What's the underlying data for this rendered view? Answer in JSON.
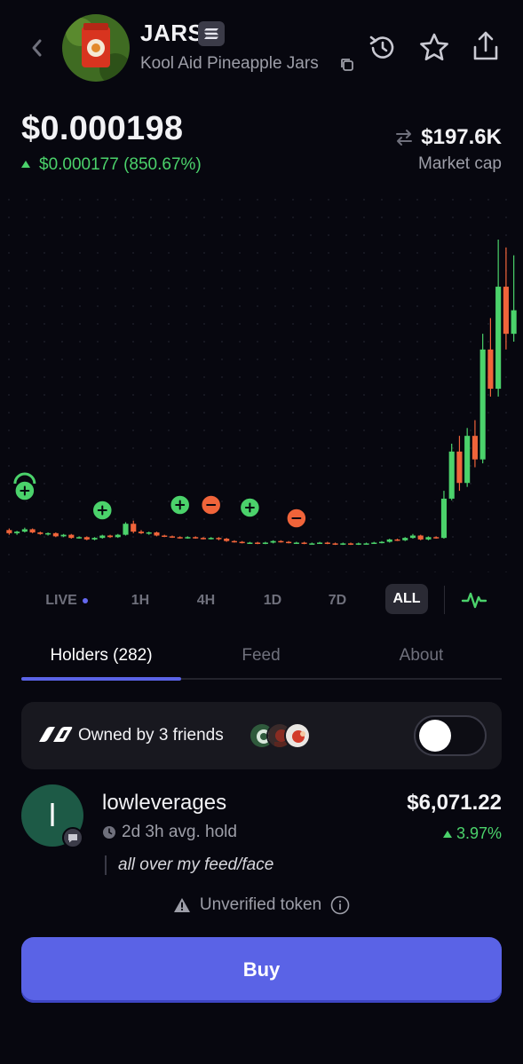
{
  "header": {
    "ticker": "JARS",
    "token_name": "Kool Aid Pineapple Jars",
    "icons": [
      "back-icon",
      "chain-badge-icon",
      "copy-icon",
      "history-icon",
      "star-icon",
      "share-icon"
    ]
  },
  "price": {
    "current": "$0.000198",
    "change": "$0.000177 (850.67%)",
    "market_cap_value": "$197.6K",
    "market_cap_label": "Market cap"
  },
  "chart_data": {
    "type": "candlestick",
    "title": "",
    "xlabel": "",
    "ylabel": "",
    "grid": true,
    "up_color": "#4bd26b",
    "down_color": "#f0643a",
    "note_markers": [
      "buy",
      "buy",
      "buy",
      "sell",
      "buy",
      "sell"
    ],
    "candles": [
      [
        50,
        46,
        52,
        44
      ],
      [
        46,
        48,
        49,
        44
      ],
      [
        48,
        51,
        53,
        47
      ],
      [
        51,
        47,
        52,
        46
      ],
      [
        47,
        45,
        48,
        44
      ],
      [
        45,
        46,
        47,
        43
      ],
      [
        46,
        42,
        47,
        41
      ],
      [
        42,
        44,
        45,
        41
      ],
      [
        44,
        40,
        45,
        39
      ],
      [
        40,
        41,
        42,
        39
      ],
      [
        41,
        38,
        42,
        37
      ],
      [
        38,
        40,
        41,
        37
      ],
      [
        40,
        43,
        44,
        39
      ],
      [
        43,
        41,
        44,
        40
      ],
      [
        41,
        44,
        45,
        40
      ],
      [
        44,
        58,
        60,
        43
      ],
      [
        58,
        48,
        62,
        46
      ],
      [
        48,
        46,
        50,
        45
      ],
      [
        46,
        47,
        48,
        44
      ],
      [
        47,
        43,
        48,
        42
      ],
      [
        43,
        42,
        44,
        41
      ],
      [
        42,
        41,
        43,
        40
      ],
      [
        41,
        40,
        42,
        39
      ],
      [
        40,
        41,
        42,
        39
      ],
      [
        41,
        40,
        42,
        39
      ],
      [
        40,
        39,
        41,
        38
      ],
      [
        39,
        40,
        41,
        38
      ],
      [
        40,
        39,
        41,
        37
      ],
      [
        39,
        36,
        40,
        35
      ],
      [
        36,
        35,
        37,
        34
      ],
      [
        35,
        34,
        36,
        33
      ],
      [
        34,
        34,
        35,
        33
      ],
      [
        34,
        33,
        35,
        32
      ],
      [
        33,
        34,
        35,
        32
      ],
      [
        34,
        36,
        37,
        33
      ],
      [
        36,
        35,
        37,
        34
      ],
      [
        35,
        34,
        36,
        33
      ],
      [
        34,
        34,
        35,
        33
      ],
      [
        34,
        33,
        35,
        32
      ],
      [
        33,
        33,
        34,
        32
      ],
      [
        33,
        34,
        35,
        33
      ],
      [
        34,
        33,
        35,
        32
      ],
      [
        33,
        32,
        34,
        31
      ],
      [
        32,
        33,
        34,
        31
      ],
      [
        33,
        32,
        34,
        31
      ],
      [
        32,
        33,
        34,
        31
      ],
      [
        33,
        33,
        34,
        32
      ],
      [
        33,
        34,
        35,
        33
      ],
      [
        34,
        35,
        36,
        33
      ],
      [
        35,
        38,
        39,
        34
      ],
      [
        38,
        37,
        39,
        36
      ],
      [
        37,
        40,
        41,
        36
      ],
      [
        40,
        43,
        45,
        39
      ],
      [
        43,
        38,
        44,
        37
      ],
      [
        38,
        41,
        42,
        37
      ],
      [
        41,
        40,
        42,
        39
      ],
      [
        40,
        90,
        100,
        39
      ],
      [
        90,
        150,
        160,
        88
      ],
      [
        150,
        110,
        170,
        100
      ],
      [
        110,
        170,
        180,
        105
      ],
      [
        170,
        140,
        190,
        130
      ],
      [
        140,
        280,
        300,
        135
      ],
      [
        280,
        230,
        320,
        220
      ],
      [
        230,
        360,
        420,
        220
      ],
      [
        360,
        300,
        410,
        280
      ],
      [
        300,
        330,
        400,
        290
      ]
    ]
  },
  "time_ranges": {
    "live": "LIVE",
    "h1": "1H",
    "h4": "4H",
    "d1": "1D",
    "d7": "7D",
    "all": "ALL",
    "selected": "ALL"
  },
  "tabs": {
    "holders": "Holders (282)",
    "feed": "Feed",
    "about": "About",
    "selected": "Holders (282)"
  },
  "friends": {
    "text": "Owned by 3 friends",
    "toggle_on": false
  },
  "holder": {
    "initial": "l",
    "name": "lowleverages",
    "hold": "2d 3h avg. hold",
    "value": "$6,071.22",
    "change": "3.97%",
    "quote": "all over my feed/face"
  },
  "unverified": "Unverified token",
  "buy_label": "Buy",
  "colors": {
    "background": "#07070f",
    "accent": "#5a63e6",
    "positive": "#4bd26b",
    "negative": "#f0643a",
    "muted": "#9d9ea8"
  }
}
